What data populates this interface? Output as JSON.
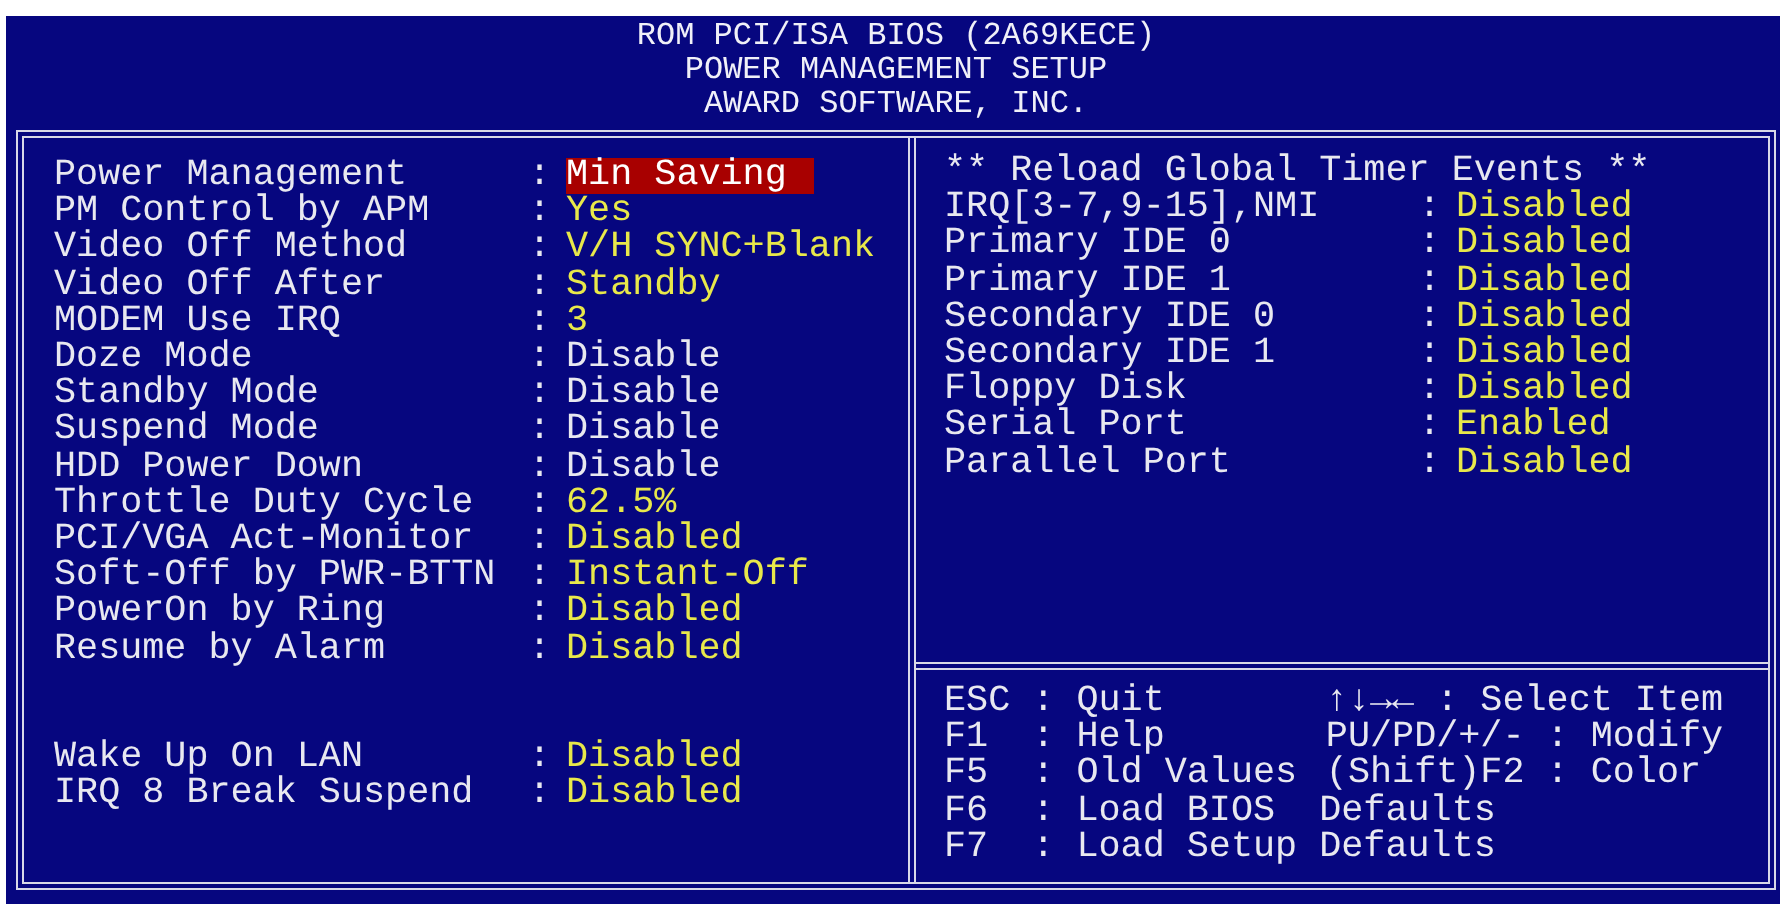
{
  "header": {
    "lines": [
      "ROM PCI/ISA BIOS (2A69KECE)",
      "POWER MANAGEMENT SETUP",
      "AWARD SOFTWARE, INC."
    ]
  },
  "setup_items": [
    {
      "label": "Power Management",
      "separator": ":",
      "value": "Min Saving",
      "selected": true,
      "disabled": false
    },
    {
      "label": "PM Control by APM",
      "separator": ":",
      "value": "Yes",
      "selected": false,
      "disabled": false
    },
    {
      "label": "Video Off Method",
      "separator": ":",
      "value": "V/H SYNC+Blank",
      "selected": false,
      "disabled": false
    },
    {
      "label": "Video Off After",
      "separator": ":",
      "value": "Standby",
      "selected": false,
      "disabled": false
    },
    {
      "label": "MODEM Use IRQ",
      "separator": ":",
      "value": "3",
      "selected": false,
      "disabled": false
    },
    {
      "label": "Doze Mode",
      "separator": ":",
      "value": "Disable",
      "selected": false,
      "disabled": true
    },
    {
      "label": "Standby Mode",
      "separator": ":",
      "value": "Disable",
      "selected": false,
      "disabled": true
    },
    {
      "label": "Suspend Mode",
      "separator": ":",
      "value": "Disable",
      "selected": false,
      "disabled": true
    },
    {
      "label": "HDD Power Down",
      "separator": ":",
      "value": "Disable",
      "selected": false,
      "disabled": true
    },
    {
      "label": "Throttle Duty Cycle",
      "separator": ":",
      "value": "62.5%",
      "selected": false,
      "disabled": false
    },
    {
      "label": "PCI/VGA Act-Monitor",
      "separator": ":",
      "value": "Disabled",
      "selected": false,
      "disabled": false
    },
    {
      "label": "Soft-Off by PWR-BTTN",
      "separator": ":",
      "value": "Instant-Off",
      "selected": false,
      "disabled": false
    },
    {
      "label": "PowerOn by Ring",
      "separator": ":",
      "value": "Disabled",
      "selected": false,
      "disabled": false
    },
    {
      "label": "Resume by Alarm",
      "separator": ":",
      "value": "Disabled",
      "selected": false,
      "disabled": false
    }
  ],
  "lan_items": [
    {
      "label": "Wake Up On LAN",
      "separator": ":",
      "value": "Disabled",
      "selected": false,
      "disabled": false
    },
    {
      "label": "IRQ 8 Break Suspend",
      "separator": ":",
      "value": "Disabled",
      "selected": false,
      "disabled": false
    }
  ],
  "timer_events": {
    "heading": "** Reload Global Timer Events **",
    "items": [
      {
        "label": "IRQ[3-7,9-15],NMI",
        "separator": ":",
        "value": "Disabled",
        "selected": false,
        "disabled": false
      },
      {
        "label": "Primary IDE 0",
        "separator": ":",
        "value": "Disabled",
        "selected": false,
        "disabled": false
      },
      {
        "label": "Primary IDE 1",
        "separator": ":",
        "value": "Disabled",
        "selected": false,
        "disabled": false
      },
      {
        "label": "Secondary IDE 0",
        "separator": ":",
        "value": "Disabled",
        "selected": false,
        "disabled": false
      },
      {
        "label": "Secondary IDE 1",
        "separator": ":",
        "value": "Disabled",
        "selected": false,
        "disabled": false
      },
      {
        "label": "Floppy Disk",
        "separator": ":",
        "value": "Disabled",
        "selected": false,
        "disabled": false
      },
      {
        "label": "Serial Port",
        "separator": ":",
        "value": "Enabled",
        "selected": false,
        "disabled": false
      },
      {
        "label": "Parallel Port",
        "separator": ":",
        "value": "Disabled",
        "selected": false,
        "disabled": false
      }
    ]
  },
  "help": {
    "left": [
      "ESC : Quit",
      "F1  : Help",
      "F5  : Old Values",
      "F6  : Load BIOS  Defaults",
      "F7  : Load Setup Defaults"
    ],
    "right": [
      "↑↓→← : Select Item",
      "PU/PD/+/- : Modify",
      "(Shift)F2 : Color"
    ]
  }
}
